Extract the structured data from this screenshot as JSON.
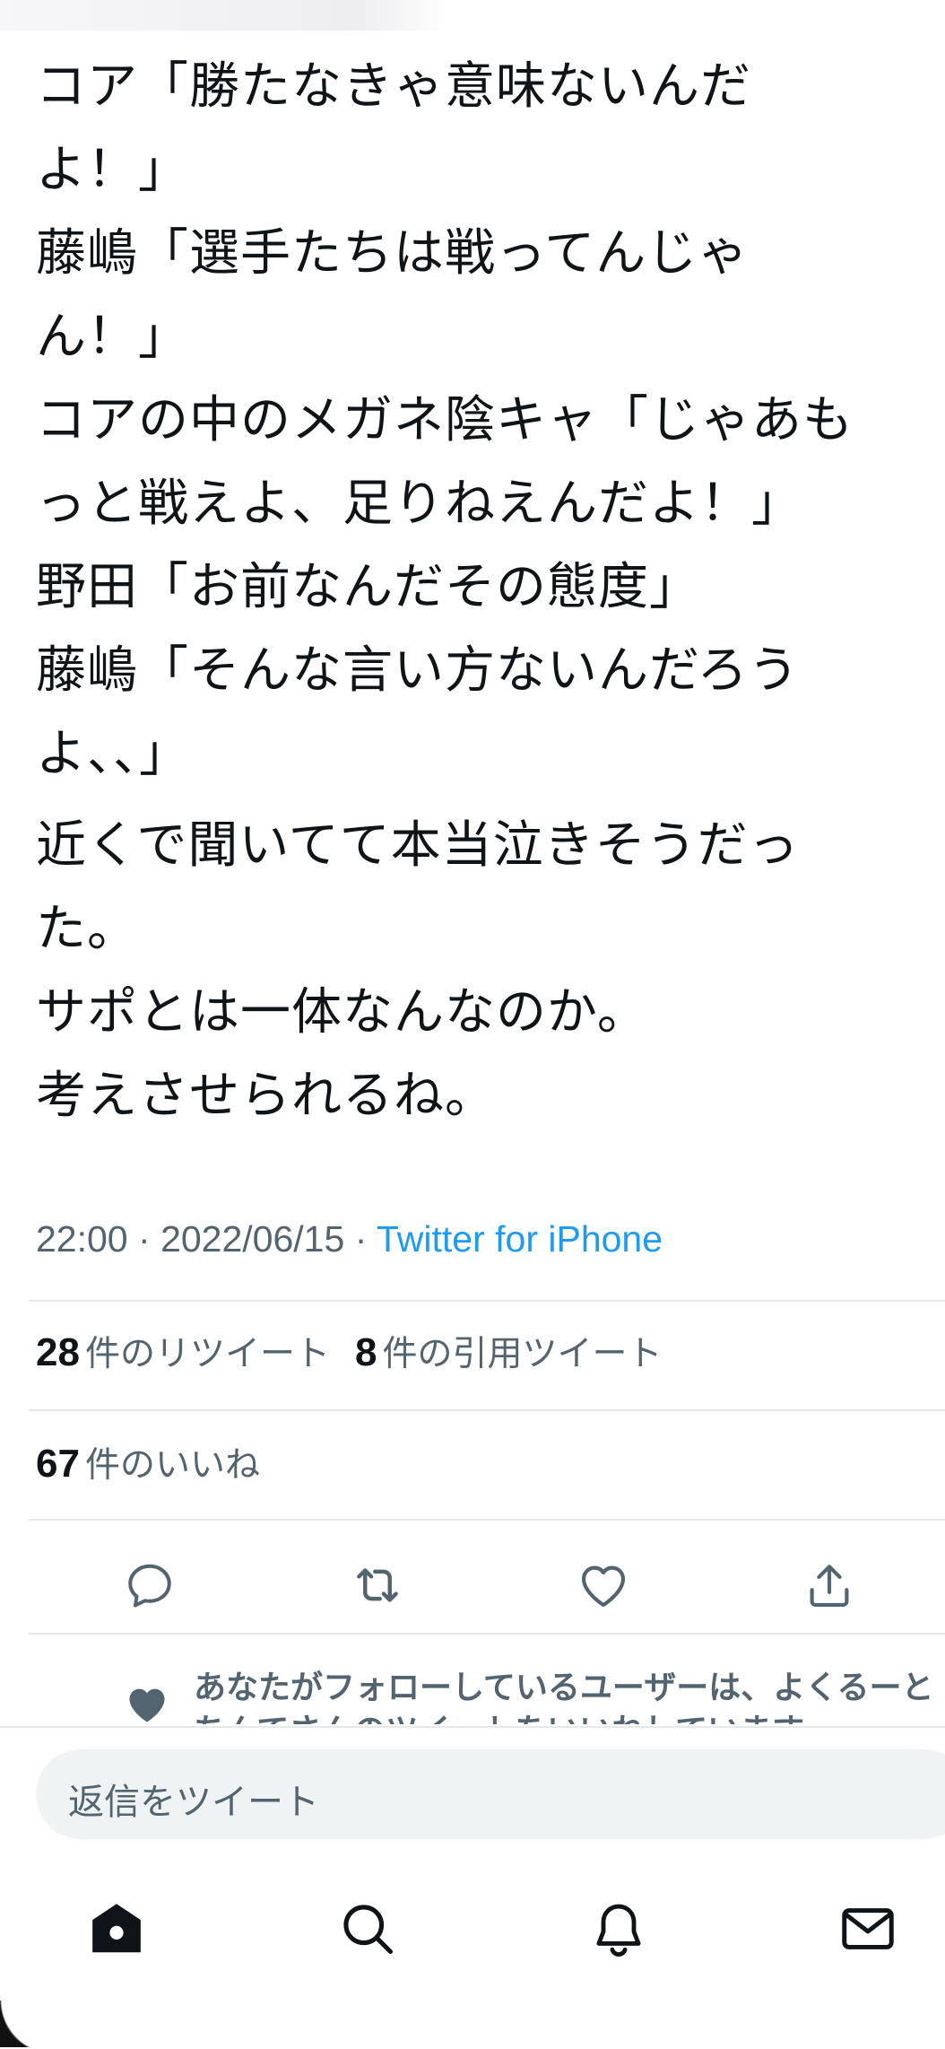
{
  "tweet": {
    "lines": [
      "コア「勝たなきゃ意味ないんだ",
      "よ！」",
      "藤嶋「選手たちは戦ってんじゃ",
      "ん！」",
      "コアの中のメガネ陰キャ「じゃあも",
      "っと戦えよ、足りねえんだよ！」",
      "野田「お前なんだその態度」",
      "藤嶋「そんな言い方ないんだろう",
      "よ、、」"
    ],
    "lines2": [
      "近くで聞いてて本当泣きそうだっ",
      "た。",
      "サポとは一体なんなのか。",
      "考えさせられるね。"
    ],
    "time": "22:00",
    "date": "2022/06/15",
    "separator": "·",
    "source": "Twitter for iPhone"
  },
  "stats": {
    "retweets_count": "28",
    "retweets_label": "件のリツイート",
    "quotes_count": "8",
    "quotes_label": "件の引用ツイート",
    "likes_count": "67",
    "likes_label": "件のいいね"
  },
  "actions": {
    "reply_icon": "reply-icon",
    "retweet_icon": "retweet-icon",
    "like_icon": "heart-icon",
    "share_icon": "share-icon"
  },
  "social_context": {
    "line1": "あなたがフォローしているユーザーは、よくるーと",
    "line2": "ちんてさんのツイートをいいねしています"
  },
  "reply": {
    "placeholder": "返信をツイート"
  },
  "nav": {
    "items": [
      "home-icon",
      "search-icon",
      "notifications-icon",
      "messages-icon"
    ]
  }
}
